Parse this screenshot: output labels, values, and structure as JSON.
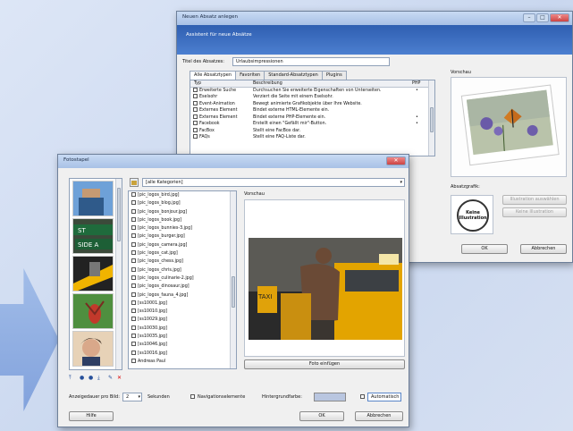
{
  "new_paragraph_dialog": {
    "title": "Neuen Absatz anlegen",
    "banner": "Assistent für neue Absätze",
    "title_label": "Titel des Absatzes:",
    "title_value": "Urlaubsimpressionen",
    "tabs": [
      "Alle Absatztypen",
      "Favoriten",
      "Standard-Absatztypen",
      "Plugins"
    ],
    "columns": {
      "type": "Typ",
      "description": "Beschreibung",
      "php": "PHP"
    },
    "rows": [
      {
        "type": "Erweiterte Suche",
        "description": "Durchsuchen Sie erweiterte Eigenschaften von Unterseiten.",
        "php": "•"
      },
      {
        "type": "Eselsohr",
        "description": "Verziert die Seite mit einem Eselsohr.",
        "php": ""
      },
      {
        "type": "Event-Animation",
        "description": "Bewegt animierte Grafikobjekte über Ihre Website.",
        "php": ""
      },
      {
        "type": "Externes Element",
        "description": "Bindet externe HTML-Elemente ein.",
        "php": ""
      },
      {
        "type": "Externes Element",
        "description": "Bindet externe PHP-Elemente ein.",
        "php": "•"
      },
      {
        "type": "Facebook",
        "description": "Erstellt einen \"Gefällt mir\"-Button.",
        "php": "•"
      },
      {
        "type": "FacBox",
        "description": "Stellt eine FacBox dar.",
        "php": ""
      },
      {
        "type": "FAQs",
        "description": "Stellt eine FAQ-Liste dar.",
        "php": ""
      }
    ],
    "preview_label": "Vorschau",
    "graphic_label": "Absatzgrafik:",
    "no_illustration": "Keine Illustration",
    "choose_illustration": "Illustration auswählen",
    "no_illustration_button": "Keine Illustration",
    "ok": "OK",
    "cancel": "Abbrechen"
  },
  "photo_stack_dialog": {
    "title": "Fotostapel",
    "category_value": "[alle Kategorien]",
    "files": [
      "[pic_logos_bird.jpg]",
      "[pic_logos_blog.jpg]",
      "[pic_logos_bonjour.jpg]",
      "[pic_logos_book.jpg]",
      "[pic_logos_bunnies-3.jpg]",
      "[pic_logos_burger.jpg]",
      "[pic_logos_camera.jpg]",
      "[pic_logos_cat.jpg]",
      "[pic_logos_chess.jpg]",
      "[pic_logos_chris.jpg]",
      "[pic_logos_culinarie-2.jpg]",
      "[pic_logos_dinosaur.jpg]",
      "[pic_logos_fauna_4.jpg]",
      "[ss10001.jpg]",
      "[ss10010.jpg]",
      "[ss10029.jpg]",
      "[ss10030.jpg]",
      "[ss10035.jpg]",
      "[ss10046.jpg]",
      "[ss10016.jpg]",
      "Andreas Paul"
    ],
    "preview_label": "Vorschau",
    "insert_photo": "Foto einfügen",
    "duration_label": "Anzeigedauer pro Bild:",
    "duration_value": "2",
    "seconds_label": "Sekunden",
    "nav_label": "Navigationselemente",
    "bg_label": "Hintergrundfarbe:",
    "auto_label": "Automatisch",
    "help": "Hilfe",
    "ok": "OK",
    "cancel": "Abbrechen",
    "taxi_sign_text": "TAXI"
  },
  "colors": {
    "banner": "#2f5fb1",
    "arrow": "#8fb0e3",
    "taxi": "#f3b300"
  }
}
